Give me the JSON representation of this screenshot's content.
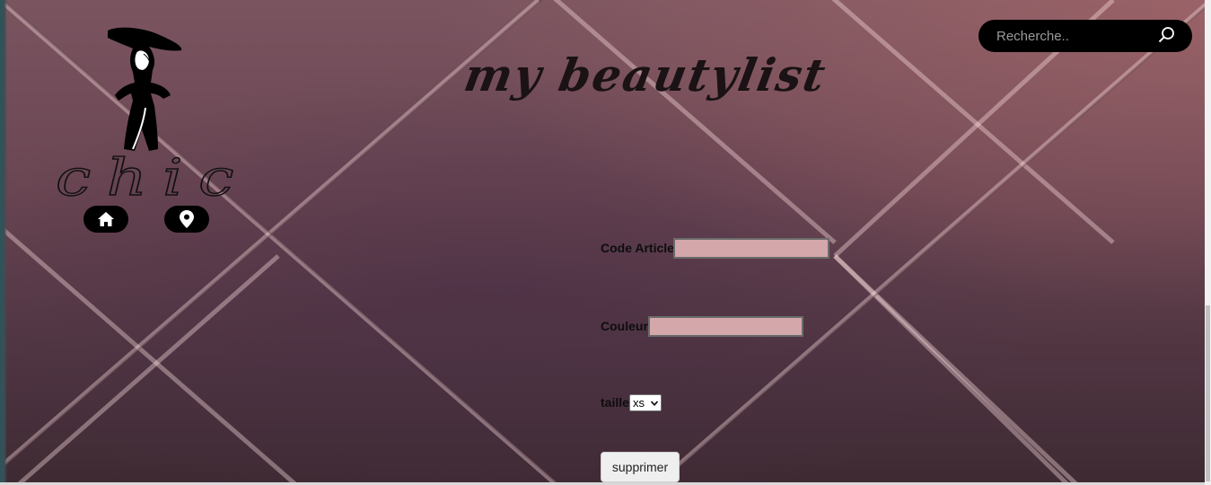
{
  "top_fragment": "",
  "logo": {
    "text": "chic",
    "accent_color": "#000000"
  },
  "site_title": "my beautylist",
  "nav": {
    "home_icon": "home-icon",
    "location_icon": "map-pin-icon"
  },
  "search": {
    "placeholder": "Recherche..",
    "value": "",
    "icon": "search-icon"
  },
  "form": {
    "code_article_label": "Code Article",
    "code_article_value": "",
    "couleur_label": "Couleur",
    "couleur_value": "",
    "taille_label": "taille",
    "taille_selected": "xs",
    "delete_label": "supprimer",
    "field_color": "#d4a7aa"
  },
  "colors": {
    "background": "#6a4552",
    "button_bg": "#000000"
  }
}
